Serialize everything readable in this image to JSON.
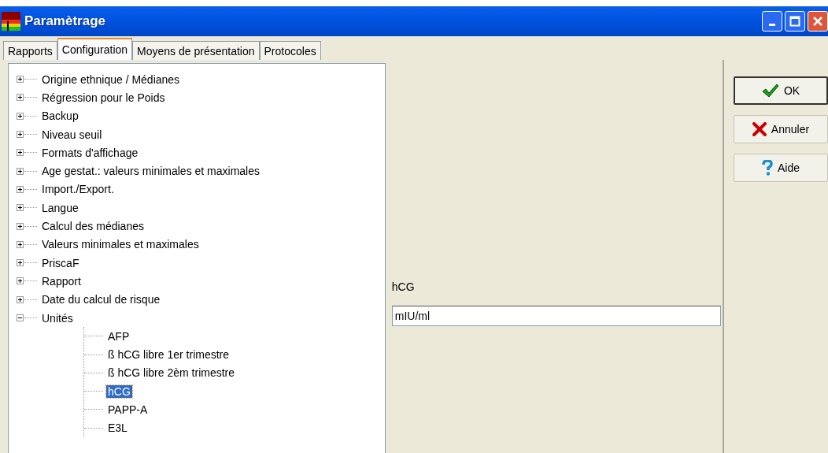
{
  "window": {
    "title": "Paramètrage"
  },
  "tabs": [
    {
      "label": "Rapports",
      "selected": false
    },
    {
      "label": "Configuration",
      "selected": true
    },
    {
      "label": "Moyens de présentation",
      "selected": false
    },
    {
      "label": "Protocoles",
      "selected": false
    }
  ],
  "tree": [
    {
      "label": "Origine ethnique / Médianes",
      "expanded": false,
      "selected": false
    },
    {
      "label": "Régression pour le Poids",
      "expanded": false,
      "selected": false
    },
    {
      "label": "Backup",
      "expanded": false,
      "selected": false
    },
    {
      "label": "Niveau seuil",
      "expanded": false,
      "selected": false
    },
    {
      "label": "Formats d'affichage",
      "expanded": false,
      "selected": false
    },
    {
      "label": "Age gestat.: valeurs minimales et maximales",
      "expanded": false,
      "selected": false
    },
    {
      "label": "Import./Export.",
      "expanded": false,
      "selected": false
    },
    {
      "label": "Langue",
      "expanded": false,
      "selected": false
    },
    {
      "label": "Calcul des médianes",
      "expanded": false,
      "selected": false
    },
    {
      "label": "Valeurs minimales et maximales",
      "expanded": false,
      "selected": false
    },
    {
      "label": "PriscaF",
      "expanded": false,
      "selected": false
    },
    {
      "label": "Rapport",
      "expanded": false,
      "selected": false
    },
    {
      "label": "Date du calcul de risque",
      "expanded": false,
      "selected": false
    },
    {
      "label": "Unités",
      "expanded": true,
      "selected": false,
      "children": [
        {
          "label": "AFP",
          "selected": false
        },
        {
          "label": "ß hCG libre 1er trimestre",
          "selected": false
        },
        {
          "label": "ß hCG libre 2èm trimestre",
          "selected": false
        },
        {
          "label": "hCG",
          "selected": true
        },
        {
          "label": "PAPP-A",
          "selected": false
        },
        {
          "label": "E3L",
          "selected": false
        }
      ]
    }
  ],
  "detail": {
    "label": "hCG",
    "value": "mIU/ml"
  },
  "buttons": [
    {
      "kind": "ok",
      "label": "OK",
      "default": true
    },
    {
      "kind": "cancel",
      "label": "Annuler",
      "default": false
    },
    {
      "kind": "help",
      "label": "Aide",
      "default": false
    }
  ]
}
